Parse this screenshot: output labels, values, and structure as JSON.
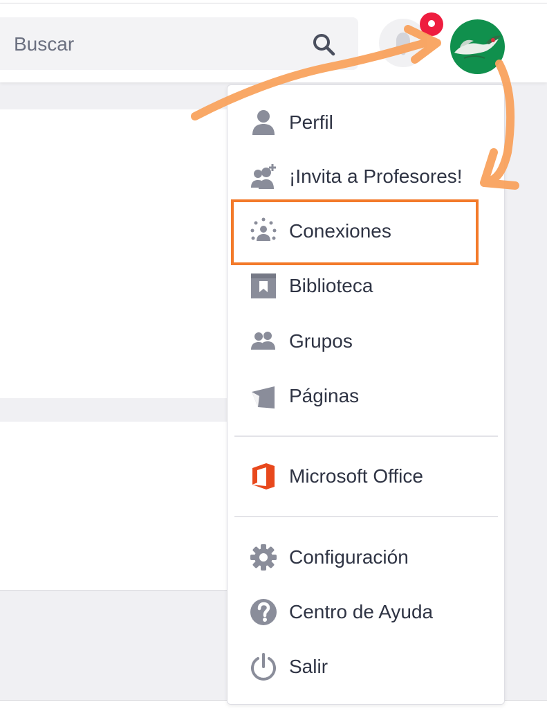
{
  "header": {
    "search": {
      "placeholder": "Buscar",
      "icon": "search-icon"
    },
    "notifications": {
      "icon": "bell-icon",
      "badge_color": "#ee1d3f"
    },
    "avatar": {
      "icon": "user-avatar",
      "bg_color": "#10904d"
    }
  },
  "menu": {
    "items": [
      {
        "label": "Perfil",
        "icon": "person-icon"
      },
      {
        "label": "¡Invita a Profesores!",
        "icon": "invite-users-icon"
      },
      {
        "label": "Conexiones",
        "icon": "connections-icon"
      },
      {
        "label": "Biblioteca",
        "icon": "library-icon"
      },
      {
        "label": "Grupos",
        "icon": "groups-icon"
      },
      {
        "label": "Páginas",
        "icon": "pages-icon"
      },
      {
        "label": "Microsoft Office",
        "icon": "microsoft-office-icon"
      },
      {
        "label": "Configuración",
        "icon": "gear-icon"
      },
      {
        "label": "Centro de Ayuda",
        "icon": "help-icon"
      },
      {
        "label": "Salir",
        "icon": "power-icon"
      }
    ],
    "highlighted_item": "Conexiones"
  },
  "colors": {
    "annotation_arrow": "#f9a35e",
    "highlight_box": "#f37a2a",
    "icon_gray": "#8a8d9a",
    "office_orange": "#e8481c"
  }
}
